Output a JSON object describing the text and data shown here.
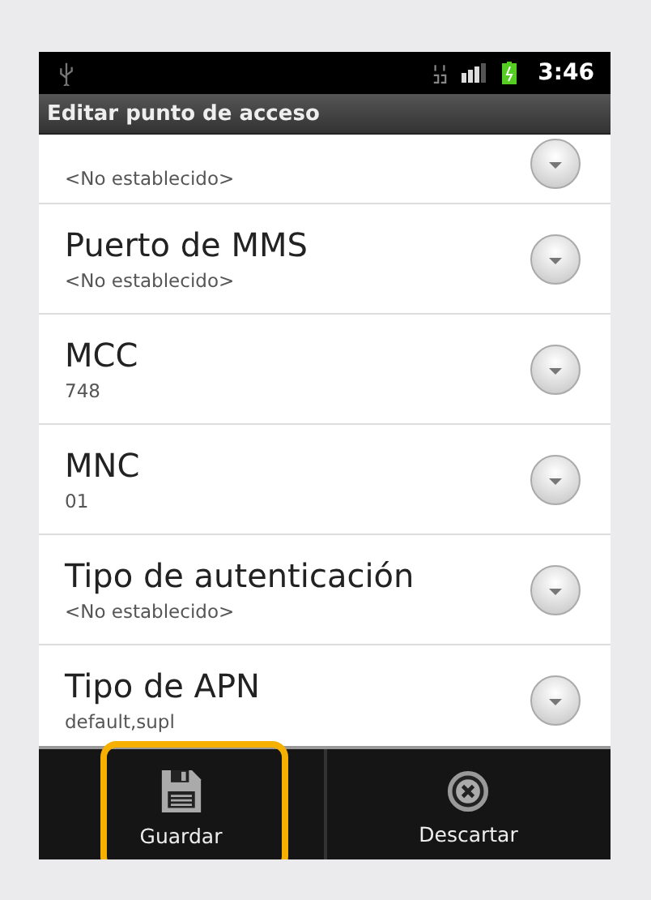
{
  "status_bar": {
    "time": "3:46"
  },
  "title_bar": {
    "title": "Editar punto de acceso"
  },
  "settings": [
    {
      "value": "<No establecido>"
    },
    {
      "title": "Puerto de MMS",
      "value": "<No establecido>"
    },
    {
      "title": "MCC",
      "value": "748"
    },
    {
      "title": "MNC",
      "value": "01"
    },
    {
      "title": "Tipo de autenticación",
      "value": "<No establecido>"
    },
    {
      "title": "Tipo de APN",
      "value": "default,supl"
    }
  ],
  "action_bar": [
    {
      "kind": "save",
      "label": "Guardar",
      "highlighted": true
    },
    {
      "kind": "discard",
      "label": "Descartar",
      "highlighted": false
    }
  ]
}
